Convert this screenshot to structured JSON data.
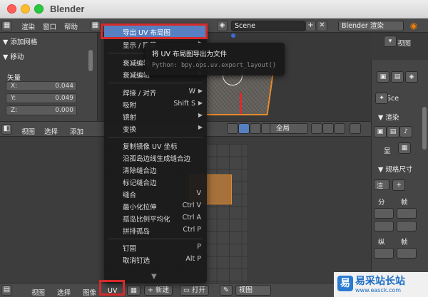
{
  "app": {
    "title": "Blender"
  },
  "infobar": {
    "menus": [
      "渲染",
      "窗口",
      "帮助"
    ],
    "scene": "Scene",
    "engine": "Blender 渲染"
  },
  "toolpanel": {
    "add_mesh": "添加网格",
    "move_header": "移动",
    "vector_label": "矢量",
    "axes": [
      {
        "label": "X:",
        "value": "0.044"
      },
      {
        "label": "Y:",
        "value": "0.049"
      },
      {
        "label": "Z:",
        "value": "0.000"
      }
    ]
  },
  "view3d_header": {
    "items": [
      "视图",
      "选择",
      "添加"
    ],
    "transform_space": "全局"
  },
  "uv_header": {
    "view": "视图",
    "select": "选择",
    "image": "图像",
    "uv": "UV",
    "new": "新建",
    "open": "打开",
    "view2": "视图"
  },
  "menu": {
    "items": [
      {
        "label": "导出 UV 布局图",
        "shortcut": "",
        "highlight": true
      },
      {
        "label": "显示 / 隐藏",
        "shortcut": "",
        "arrow": true
      },
      {
        "label": "衰减编辑",
        "shortcut": "",
        "arrow": true
      },
      {
        "label": "衰减编辑",
        "shortcut": "",
        "arrow": true
      },
      {
        "label": "焊接 / 对齐",
        "shortcut": "W",
        "arrow": true
      },
      {
        "label": "吸附",
        "shortcut": "Shift S",
        "arrow": true
      },
      {
        "label": "镜射",
        "shortcut": "",
        "arrow": true
      },
      {
        "label": "变换",
        "shortcut": "",
        "arrow": true
      },
      {
        "label": "复制镜像 UV 坐标",
        "shortcut": ""
      },
      {
        "label": "沿孤岛边线生成缝合边",
        "shortcut": ""
      },
      {
        "label": "清除缝合边",
        "shortcut": ""
      },
      {
        "label": "标记缝合边",
        "shortcut": ""
      },
      {
        "label": "缝合",
        "shortcut": "V"
      },
      {
        "label": "最小化拉伸",
        "shortcut": "Ctrl V"
      },
      {
        "label": "孤岛比例平均化",
        "shortcut": "Ctrl A"
      },
      {
        "label": "拼排孤岛",
        "shortcut": "Ctrl P"
      },
      {
        "label": "钉固",
        "shortcut": "P"
      },
      {
        "label": "取消钉选",
        "shortcut": "Alt P"
      }
    ]
  },
  "tooltip": {
    "title": "将 UV 布局图导出为文件",
    "python": "Python: bpy.ops.uv.export_layout()"
  },
  "props": {
    "view": "视图",
    "sce": "Sce",
    "render": "渲染",
    "display": "显",
    "dimensions": "规格尺寸",
    "res": "渲",
    "frame_a": "分",
    "frame_b": "帧",
    "aspect": "纵",
    "frame_c": "帧"
  },
  "watermark": {
    "text": "易采站长站",
    "url": "www.easck.com"
  }
}
